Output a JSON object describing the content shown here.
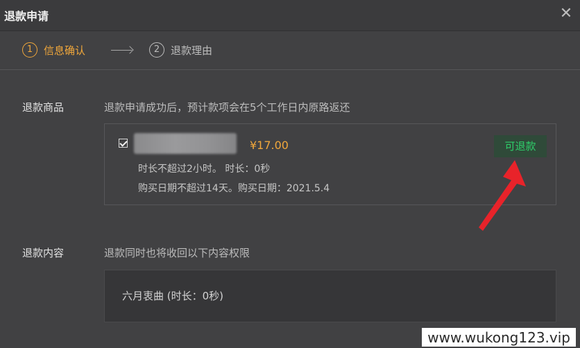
{
  "dialog": {
    "title": "退款申请",
    "close_symbol": "✕"
  },
  "steps": [
    {
      "num": "1",
      "label": "信息确认",
      "active": true,
      "color": "#f0a73b"
    },
    {
      "num": "2",
      "label": "退款理由",
      "active": false,
      "color": "#bdbdbd"
    }
  ],
  "product_section": {
    "label": "退款商品",
    "hint": "退款申请成功后，预计款项会在5个工作日内原路返还",
    "item": {
      "checked": true,
      "price": "¥17.00",
      "duration_text": "时长不超过2小时。 时长：0秒",
      "purchase_text": "购买日期不超过14天。购买日期：2021.5.4",
      "badge": "可退款"
    }
  },
  "content_section": {
    "label": "退款内容",
    "hint": "退款同时也将收回以下内容权限",
    "item": "六月衷曲 (时长：0秒)"
  },
  "watermark": "www.wukong123.vip",
  "colors": {
    "accent": "#f0a73b",
    "success": "#2fcf6a",
    "annotation_arrow": "#e8232a"
  }
}
